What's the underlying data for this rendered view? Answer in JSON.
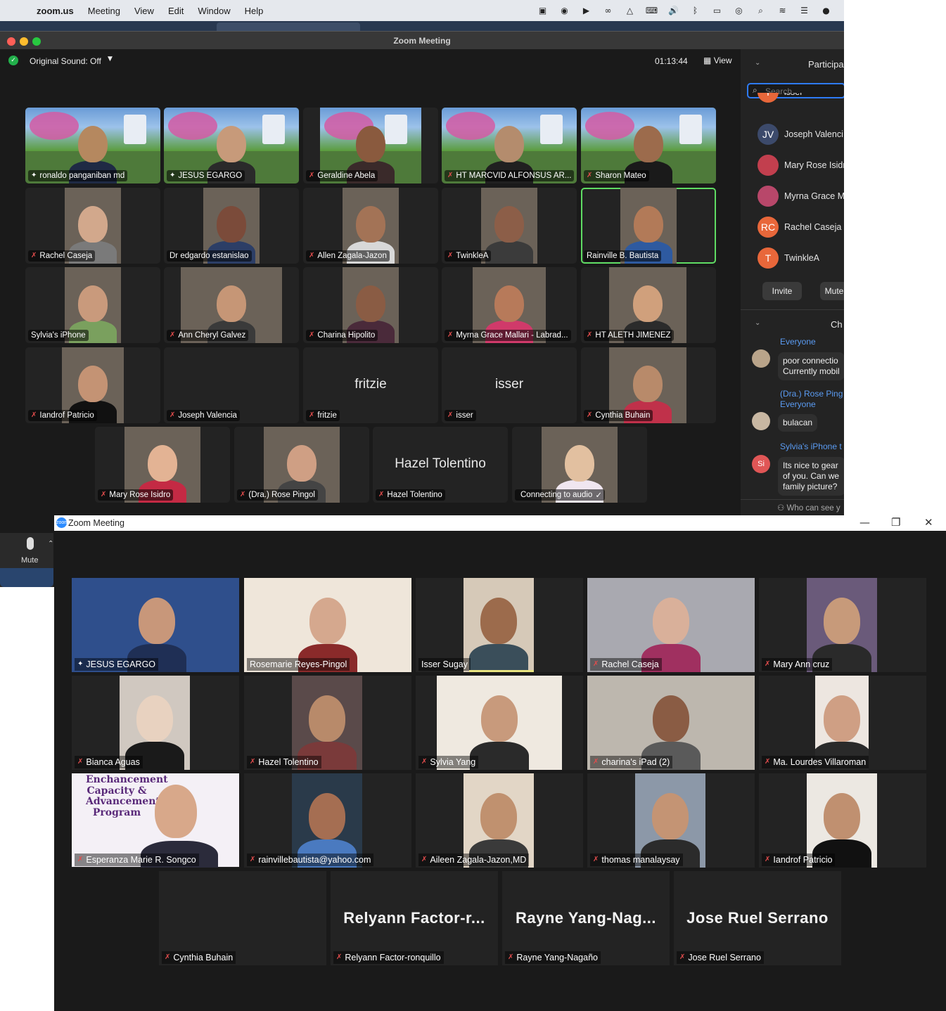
{
  "mac": {
    "menubar": {
      "app": "zoom.us",
      "menus": [
        "Meeting",
        "View",
        "Edit",
        "Window",
        "Help"
      ]
    },
    "window_title": "Zoom Meeting",
    "original_sound": "Original Sound: Off",
    "timer": "01:13:44",
    "view_label": "View",
    "tiles": [
      {
        "name": "ronaldo panganiban md",
        "icon": "pin-icon"
      },
      {
        "name": "JESUS EGARGO",
        "icon": "pin-icon"
      },
      {
        "name": "Geraldine Abela",
        "icon": "mic-muted-icon"
      },
      {
        "name": "HT MARCVID ALFONSUS AR...",
        "icon": "mic-muted-icon"
      },
      {
        "name": "Sharon Mateo",
        "icon": "mic-muted-icon"
      },
      {
        "name": "Rachel Caseja",
        "icon": "mic-muted-icon"
      },
      {
        "name": "Dr edgardo estanislao",
        "icon": ""
      },
      {
        "name": "Allen Zagala-Jazon",
        "icon": "mic-muted-icon"
      },
      {
        "name": "TwinkleA",
        "icon": "mic-muted-icon"
      },
      {
        "name": "Rainville B. Bautista",
        "icon": "",
        "active": true
      },
      {
        "name": "Sylvia's iPhone",
        "icon": ""
      },
      {
        "name": "Ann Cheryl Galvez",
        "icon": "mic-muted-icon"
      },
      {
        "name": "Charina Hipolito",
        "icon": "mic-muted-icon"
      },
      {
        "name": "Myrna Grace Mallari - Labrad...",
        "icon": "mic-muted-icon"
      },
      {
        "name": "HT ALETH JIMENEZ",
        "icon": "mic-muted-icon"
      },
      {
        "name": "Iandrof Patricio",
        "icon": "mic-muted-icon"
      },
      {
        "name": "Joseph Valencia",
        "icon": "mic-muted-icon"
      },
      {
        "name": "fritzie",
        "icon": "mic-muted-icon",
        "big": "fritzie"
      },
      {
        "name": "isser",
        "icon": "mic-muted-icon",
        "big": "isser"
      },
      {
        "name": "Cynthia Buhain",
        "icon": "mic-muted-icon"
      },
      {
        "name": "Mary Rose Isidro",
        "icon": "mic-muted-icon"
      },
      {
        "name": "(Dra.) Rose Pingol",
        "icon": "mic-muted-icon"
      },
      {
        "name": "Hazel Tolentino",
        "icon": "mic-muted-icon",
        "big": "Hazel Tolentino"
      },
      {
        "name": "Connecting to audio",
        "icon": "check-icon"
      }
    ],
    "panel": {
      "participants_header": "Participa",
      "search_placeholder": "Search",
      "participants": [
        {
          "initials": "I",
          "name": "isser",
          "color": "#e8673a"
        },
        {
          "initials": "JV",
          "name": "Joseph Valenci",
          "color": "#3c4a6b"
        },
        {
          "initials": "",
          "name": "Mary Rose Isidr",
          "color": "#c23f4e"
        },
        {
          "initials": "",
          "name": "Myrna Grace M",
          "color": "#b8476a"
        },
        {
          "initials": "RC",
          "name": "Rachel Caseja",
          "color": "#e8673a"
        },
        {
          "initials": "T",
          "name": "TwinkleA",
          "color": "#e8673a"
        }
      ],
      "invite_label": "Invite",
      "mute_label": "Mute",
      "chat_header": "Ch",
      "chat": [
        {
          "to": "Everyone",
          "text": "poor connectio\nCurrently mobil"
        },
        {
          "from": "(Dra.) Rose Ping",
          "to": "Everyone",
          "text": "bulacan"
        },
        {
          "from": "Sylvia's iPhone t",
          "avatar": "Si",
          "text": "Its nice to gear\nof you. Can we\nfamily picture?"
        }
      ],
      "who_can_see": "Who can see y"
    },
    "mute_label": "Mute"
  },
  "win": {
    "window_title": "Zoom Meeting",
    "tiles": [
      {
        "name": "JESUS EGARGO",
        "icon": "pin-icon",
        "active": true
      },
      {
        "name": "Rosemarie Reyes-Pingol",
        "icon": ""
      },
      {
        "name": "Isser Sugay",
        "icon": ""
      },
      {
        "name": "Rachel Caseja",
        "icon": "mic-muted-icon"
      },
      {
        "name": "Mary Ann cruz",
        "icon": "mic-muted-icon"
      },
      {
        "name": "Bianca Aguas",
        "icon": "mic-muted-icon"
      },
      {
        "name": "Hazel Tolentino",
        "icon": "mic-muted-icon"
      },
      {
        "name": "Sylvia Yang",
        "icon": "mic-muted-icon"
      },
      {
        "name": "charina's iPad (2)",
        "icon": "mic-muted-icon"
      },
      {
        "name": "Ma. Lourdes Villaroman",
        "icon": "mic-muted-icon"
      },
      {
        "name": "Esperanza Marie R. Songco",
        "icon": "mic-muted-icon",
        "bg_text": "Enchancement\nCapacity &\nAdvancement\nProgram"
      },
      {
        "name": "rainvillebautista@yahoo.com",
        "icon": "mic-muted-icon"
      },
      {
        "name": "Aileen Zagala-Jazon,MD",
        "icon": "mic-muted-icon"
      },
      {
        "name": "thomas manalaysay",
        "icon": "mic-muted-icon"
      },
      {
        "name": "Iandrof Patricio",
        "icon": "mic-muted-icon"
      },
      {
        "name": "Cynthia Buhain",
        "icon": "mic-muted-icon"
      },
      {
        "name": "Relyann Factor-ronquillo",
        "icon": "mic-muted-icon",
        "big": "Relyann  Factor-r..."
      },
      {
        "name": "Rayne Yang-Nagaño",
        "icon": "mic-muted-icon",
        "big": "Rayne  Yang-Nag..."
      },
      {
        "name": "Jose Ruel Serrano",
        "icon": "mic-muted-icon",
        "big": "Jose Ruel Serrano"
      }
    ]
  }
}
